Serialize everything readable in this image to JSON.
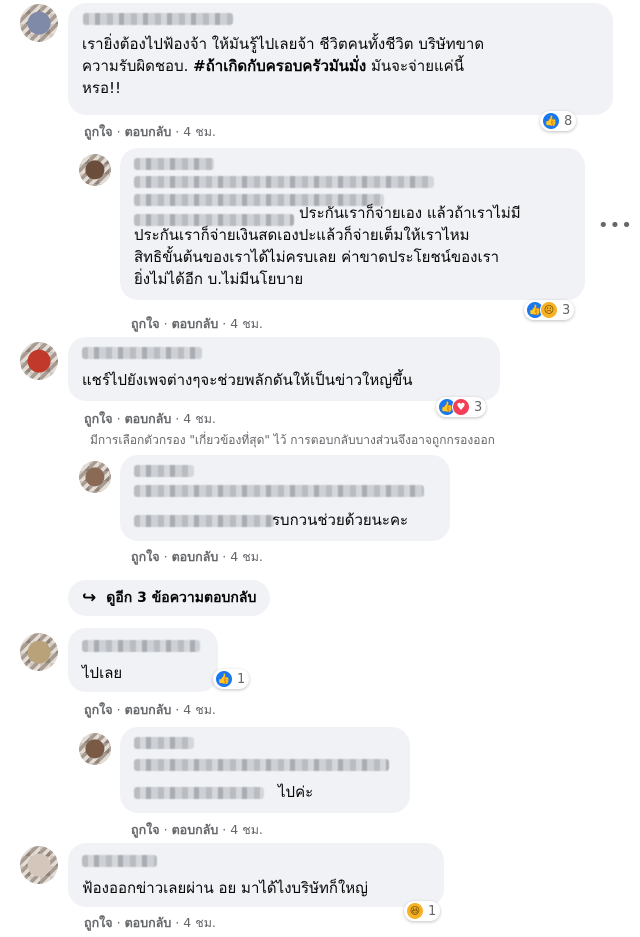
{
  "comments": [
    {
      "text": "เรายิ่งต้องไปฟ้องจ้า  ให้มันรู้ไปเลยจ้า  ชีวิตคนทั้งชีวิต  บริษัทขาด\nความรับผิดชอบ. ",
      "hashtag": "#ถ้าเกิดกับครอบครัวมันมั่ง",
      "text_end": " มันจะจ่ายแค่นี้\nหรอ!!",
      "actions": {
        "like": "ถูกใจ",
        "reply": "ตอบกลับ",
        "time": "4 ชม."
      },
      "reactions": {
        "icons": [
          "like"
        ],
        "count": "8"
      }
    },
    {
      "text": "ประกันเราก็จ่ายเอง แล้วถ้าเราไม่มี\nประกันเราก็จ่ายเงินสดเองปะแล้วก็จ่ายเต็มให้เราไหม\nสิทธิขั้นต้นของเราได้ไม่ครบเลย ค่าขาดประโยชน์ของเรา\nยิ่งไม่ได้อีก บ.ไม่มีนโยบาย",
      "actions": {
        "like": "ถูกใจ",
        "reply": "ตอบกลับ",
        "time": "4 ชม."
      },
      "reactions": {
        "icons": [
          "like",
          "sad"
        ],
        "count": "3"
      }
    },
    {
      "text": "แชร์ไปยังเพจต่างๆจะช่วยพลักดันให้เป็นข่าวใหญ่ขึ้น",
      "actions": {
        "like": "ถูกใจ",
        "reply": "ตอบกลับ",
        "time": "4 ชม."
      },
      "reactions": {
        "icons": [
          "like",
          "love"
        ],
        "count": "3"
      }
    },
    {
      "text": "รบกวนช่วยด้วยนะคะ",
      "actions": {
        "like": "ถูกใจ",
        "reply": "ตอบกลับ",
        "time": "4 ชม."
      }
    },
    {
      "text": "ไปเลย",
      "actions": {
        "like": "ถูกใจ",
        "reply": "ตอบกลับ",
        "time": "4 ชม."
      },
      "reactions": {
        "icons": [
          "like"
        ],
        "count": "1"
      }
    },
    {
      "text": "ไปค่ะ",
      "actions": {
        "like": "ถูกใจ",
        "reply": "ตอบกลับ",
        "time": "4 ชม."
      }
    },
    {
      "text": "ฟ้องออกข่าวเลยผ่าน อย มาได้ไงบริษัทก็ใหญ่",
      "actions": {
        "like": "ถูกใจ",
        "reply": "ตอบกลับ",
        "time": "4 ชม."
      },
      "reactions": {
        "icons": [
          "haha"
        ],
        "count": "1"
      }
    }
  ],
  "filter_note": "มีการเลือกตัวกรอง \"เกี่ยวข้องที่สุด\" ไว้ การตอบกลับบางส่วนจึงอาจถูกกรองออก",
  "more_replies": {
    "icon": "reply-arrow-icon",
    "label": "ดูอีก 3 ข้อความตอบกลับ"
  },
  "options_icon": "more-options-icon",
  "colors": {
    "bubble": "#f0f2f5",
    "meta": "#65676b",
    "like": "#1877f2",
    "love": "#f33e58",
    "sad": "#f7b125"
  }
}
